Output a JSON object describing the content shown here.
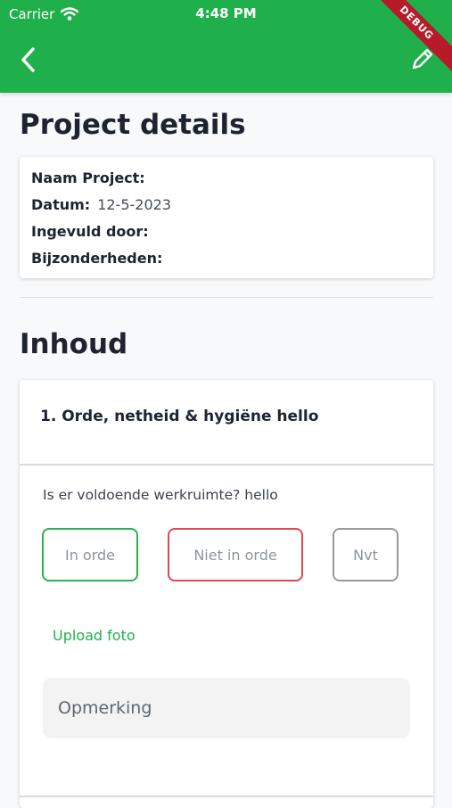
{
  "status_bar": {
    "carrier": "Carrier",
    "time": "4:48 PM"
  },
  "app_bar": {
    "debug_banner": "DEBUG",
    "icons": [
      "chevron-left-icon",
      "pencil-icon",
      "wifi-icon"
    ],
    "color": "#20b04b"
  },
  "page": {
    "title": "Project details"
  },
  "details": {
    "naam_project_label": "Naam Project:",
    "datum_label": "Datum:",
    "datum_value": "12-5-2023",
    "ingevuld_door_label": "Ingevuld door:",
    "bijzonderheden_label": "Bijzonderheden:"
  },
  "section": {
    "title": "Inhoud"
  },
  "category": {
    "title": "1. Orde, netheid & hygiëne hello",
    "question": "Is er voldoende werkruimte? hello",
    "options": {
      "ok": "In orde",
      "not_ok": "Niet in orde",
      "na": "Nvt"
    },
    "option_colors": {
      "ok": "#2cb24f",
      "not_ok": "#e0484f",
      "na": "#9a9a9a"
    },
    "upload_label": "Upload foto",
    "remark_placeholder": "Opmerking"
  }
}
